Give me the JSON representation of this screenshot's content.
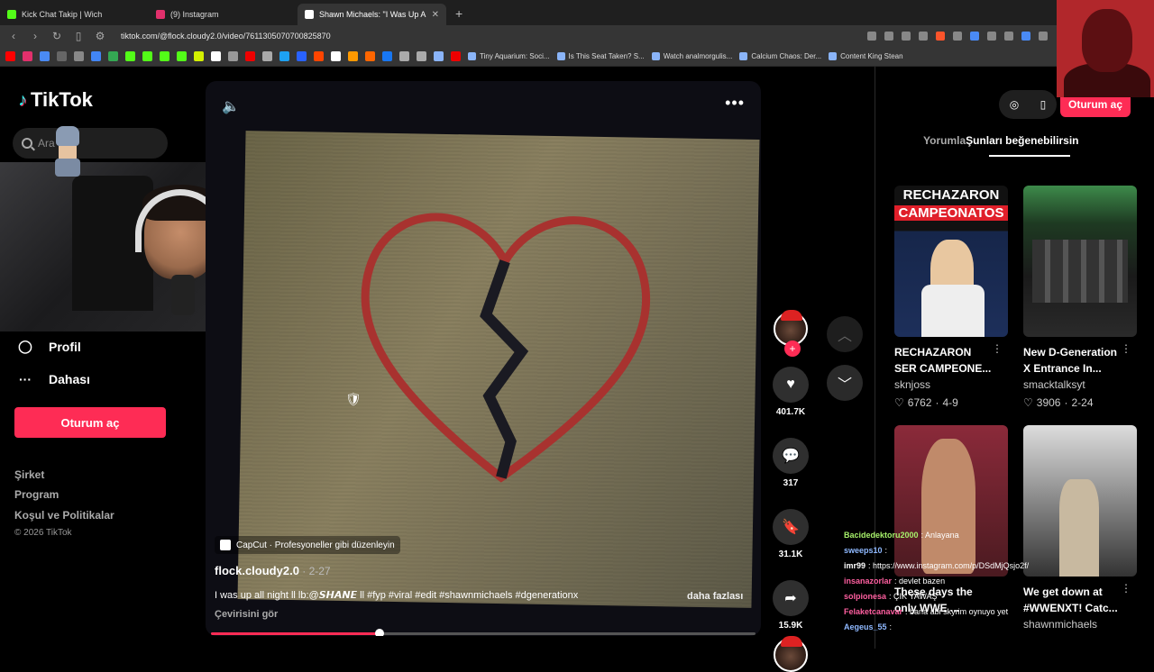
{
  "browser": {
    "tabs": [
      {
        "label": "Kick Chat Takip | Wich",
        "icon_color": "#53fc18",
        "active": false
      },
      {
        "label": "(9) Instagram",
        "icon_color": "#e1306c",
        "active": false
      },
      {
        "label": "Shawn Michaels: \"I Was Up A",
        "icon_color": "#ffffff",
        "active": true
      }
    ],
    "new_tab_label": "+",
    "close_tab_label": "✕",
    "url": "tiktok.com/@flock.cloudy2.0/video/7611305070700825870",
    "bookmarks_text": [
      "Tiny Aquarium: Soci...",
      "Is This Seat Taken? S...",
      "Watch analmorgulis...",
      "Calcium Chaos: Der...",
      "Content King Stean"
    ],
    "bookmark_icon_colors": [
      "#ff0000",
      "#e1306c",
      "#4a8af4",
      "#666",
      "#888",
      "#4285f4",
      "#34a853",
      "#53fc18",
      "#53fc18",
      "#53fc18",
      "#53fc18",
      "#d4f000",
      "#fff",
      "#999",
      "#e00",
      "#aaa",
      "#1da1f2",
      "#2962ff",
      "#ff4500",
      "#fff",
      "#ff9900",
      "#ff6600",
      "#1877f2",
      "#aaa",
      "#aaa",
      "#8ab4f8",
      "#e00"
    ]
  },
  "sidebar": {
    "logo_text": "TikTok",
    "search_placeholder": "Ara",
    "profile_label": "Profil",
    "more_label": "Dahası",
    "login_button": "Oturum aç",
    "footer_links": [
      "Şirket",
      "Program",
      "Koşul ve Politikalar"
    ],
    "copyright": "© 2026 TikTok"
  },
  "video": {
    "capcut_label": "CapCut · Profesyoneller gibi düzenleyin",
    "author": "flock.cloudy2.0",
    "date": " · 2-27",
    "caption": "I was up all night ll lb:@𝙎𝙃𝘼𝙉𝙀 ll #fyp #viral #edit #shawnmichaels #dgenerationx",
    "more_link": "daha fazlası",
    "translate_link": "Çevirisini gör",
    "progress_fraction": 0.31,
    "colors": {
      "accent": "#fe2c55"
    }
  },
  "actions": {
    "likes": "401.7K",
    "comments": "317",
    "saves": "31.1K",
    "shares": "15.9K",
    "follow_plus": "+"
  },
  "right_panel": {
    "login_button": "Oturum aç",
    "tab_comments": "Yorumla",
    "tab_suggested": "Şunları beğenebilirsin",
    "cards": [
      {
        "title": "RECHAZARON SER CAMPEONE...",
        "author": "sknjoss",
        "likes": "6762",
        "date": "4-9",
        "thumb_text_top": "RECHAZARON",
        "thumb_text_bottom": "CAMPEONATOS"
      },
      {
        "title": "New D-Generation X Entrance In...",
        "author": "smacktalksyt",
        "likes": "3906",
        "date": "2-24"
      },
      {
        "title": "These days the only WWE ...",
        "author": "",
        "likes": "",
        "date": ""
      },
      {
        "title": "We get down at #WWENXT! Catc...",
        "author": "shawnmichaels",
        "likes": "",
        "date": ""
      }
    ]
  },
  "chat": [
    {
      "user": "Bacidedektoru2000",
      "msg": ": Anlayana",
      "color": "#a6f06a"
    },
    {
      "user": "sweeps10",
      "msg": ":",
      "color": "#8fb9ff"
    },
    {
      "user": "imr99",
      "msg": ": https://www.instagram.com/p/DSdMjQsjo2f/",
      "color": "#ffffff"
    },
    {
      "user": "insanazorlar",
      "msg": ": devlet bazen",
      "color": "#ff5fa0"
    },
    {
      "user": "solpionesa",
      "msg": ": ÇIK YAWAŞ",
      "color": "#ff5fa0"
    },
    {
      "user": "Felaketcanavar",
      "msg": ": bana abi skyrim oynuyo yet",
      "color": "#ff5fa0"
    },
    {
      "user": "Aegeus_55",
      "msg": ":",
      "color": "#8fb9ff"
    }
  ]
}
